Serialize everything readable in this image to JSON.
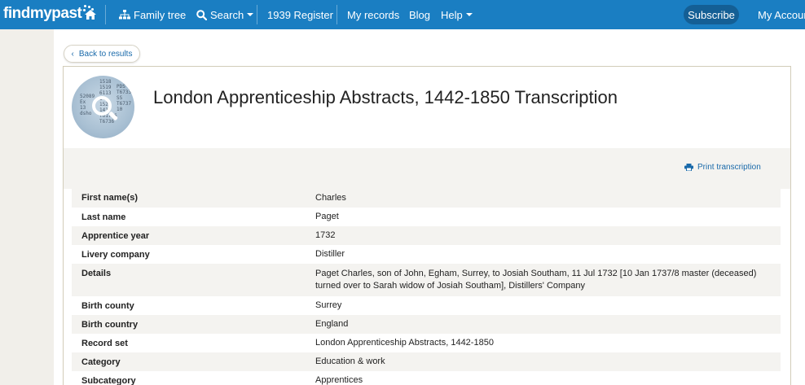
{
  "nav": {
    "logo": "findmypast",
    "items": [
      {
        "label": "Family tree",
        "icon": "sitemap-icon"
      },
      {
        "label": "Search",
        "icon": "search-icon",
        "dropdown": true
      },
      {
        "label": "1939 Register"
      },
      {
        "label": "My records"
      },
      {
        "label": "Blog"
      },
      {
        "label": "Help",
        "dropdown": true
      }
    ],
    "subscribe": "Subscribe",
    "account": "My Account"
  },
  "back": "Back to results",
  "title": "London Apprenticeship Abstracts, 1442-1850 Transcription",
  "print": "Print transcription",
  "rows": [
    {
      "label": "First name(s)",
      "value": "Charles"
    },
    {
      "label": "Last name",
      "value": "Paget"
    },
    {
      "label": "Apprentice year",
      "value": "1732"
    },
    {
      "label": "Livery company",
      "value": "Distiller"
    },
    {
      "label": "Details",
      "value": "Paget Charles, son of John, Egham, Surrey, to Josiah Southam, 11 Jul 1732 [10 Jan 1737/8 master (deceased) turned over to Sarah widow of Josiah Southam], Distillers' Company"
    },
    {
      "label": "Birth county",
      "value": "Surrey"
    },
    {
      "label": "Birth country",
      "value": "England"
    },
    {
      "label": "Record set",
      "value": "London Apprenticeship Abstracts, 1442-1850"
    },
    {
      "label": "Category",
      "value": "Education & work"
    },
    {
      "label": "Subcategory",
      "value": "Apprentices"
    }
  ],
  "colors": {
    "nav": "#1a7ec2",
    "link": "#1a6aaa",
    "stripe": "#f4f3f0"
  }
}
